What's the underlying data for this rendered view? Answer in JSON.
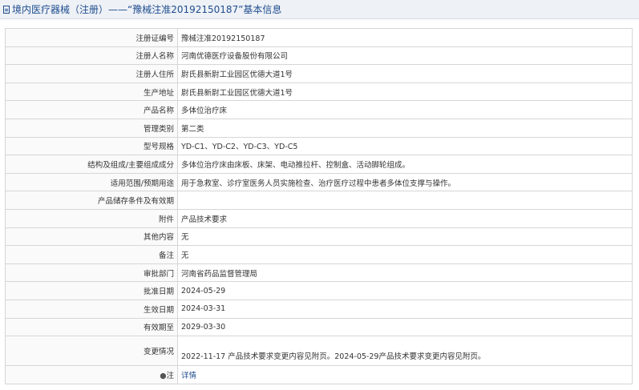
{
  "header": {
    "title": "境内医疗器械（注册）——“豫械注准20192150187”基本信息"
  },
  "rows": [
    {
      "label": "注册证编号",
      "value": "豫械注准20192150187"
    },
    {
      "label": "注册人名称",
      "value": "河南优德医疗设备股份有限公司"
    },
    {
      "label": "注册人住所",
      "value": "尉氏县新尉工业园区优德大道1号"
    },
    {
      "label": "生产地址",
      "value": "尉氏县新尉工业园区优德大道1号"
    },
    {
      "label": "产品名称",
      "value": "多体位治疗床"
    },
    {
      "label": "管理类别",
      "value": "第二类"
    },
    {
      "label": "型号规格",
      "value": "YD-C1、YD-C2、YD-C3、YD-C5"
    },
    {
      "label": "结构及组成/主要组成成分",
      "value": "多体位治疗床由床板、床架、电动推拉杆、控制盒、活动脚轮组成。"
    },
    {
      "label": "适用范围/预期用途",
      "value": "用于急救室、诊疗室医务人员实施检查、治疗医疗过程中患者多体位支撑与操作。"
    },
    {
      "label": "产品储存条件及有效期",
      "value": ""
    },
    {
      "label": "附件",
      "value": "产品技术要求"
    },
    {
      "label": "其他内容",
      "value": "无"
    },
    {
      "label": "备注",
      "value": "无"
    },
    {
      "label": "审批部门",
      "value": "河南省药品监督管理局"
    },
    {
      "label": "批准日期",
      "value": "2024-05-29"
    },
    {
      "label": "生效日期",
      "value": "2024-03-31"
    },
    {
      "label": "有效期至",
      "value": "2029-03-30"
    },
    {
      "label": "变更情况",
      "value": "2022-11-17 产品技术要求变更内容见附页。2024-05-29产品技术要求变更内容见附页。"
    }
  ],
  "note_row": {
    "bullet": "●",
    "label": "注",
    "link": "详情"
  }
}
